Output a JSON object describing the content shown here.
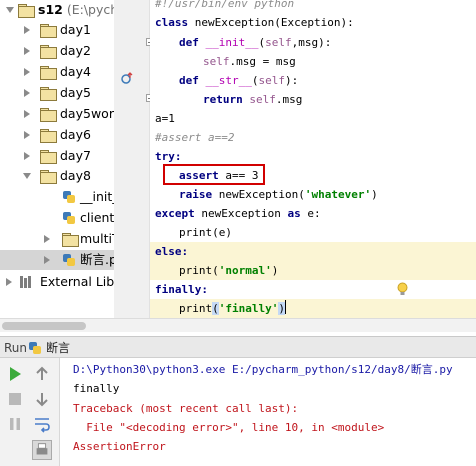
{
  "tree": {
    "root": {
      "name": "s12",
      "path": "(E:\\pycha"
    },
    "items": [
      {
        "label": "day1"
      },
      {
        "label": "day2"
      },
      {
        "label": "day4"
      },
      {
        "label": "day5"
      },
      {
        "label": "day5work"
      },
      {
        "label": "day6"
      },
      {
        "label": "day7"
      },
      {
        "label": "day8"
      }
    ],
    "day8_children": [
      {
        "label": "__init_"
      },
      {
        "label": "client."
      },
      {
        "label": "multiT"
      },
      {
        "label": "断言.py"
      }
    ],
    "external": "External Libra"
  },
  "code": {
    "shebang": "#!/usr/bin/env python",
    "l_class_kw": "class ",
    "l_class_rest": "newException(Exception):",
    "l_def1_kw": "def ",
    "l_def1_name": "__init__",
    "l_def1_a": "(",
    "l_def1_self": "self",
    "l_def1_b": ",msg):",
    "l_assign_self": "self",
    "l_assign_rest": ".msg = msg",
    "l_def2_name": "__str__",
    "l_def2_a": "(",
    "l_def2_self": "self",
    "l_def2_b": "):",
    "l_return_kw": "return ",
    "l_return_self": "self",
    "l_return_rest": ".msg",
    "l_a1": "a=1",
    "l_comment": "#assert a==2",
    "l_try": "try:",
    "l_assert_kw": "assert ",
    "l_assert_rest": "a== 3",
    "l_raise_kw": "raise ",
    "l_raise_a": "newException(",
    "l_raise_str": "'whatever'",
    "l_raise_b": ")",
    "l_except_kw": "except ",
    "l_except_a": "newException ",
    "l_except_as": "as ",
    "l_except_b": "e:",
    "l_print_e": "print(e)",
    "l_else": "else:",
    "l_print_normal_a": "print(",
    "l_print_normal_s": "'normal'",
    "l_print_normal_b": ")",
    "l_finally": "finally:",
    "l_print_finally_a": "print",
    "l_print_finally_p": "(",
    "l_print_finally_s": "'finally'",
    "l_print_finally_b": ")"
  },
  "run": {
    "tab_label": "Run",
    "config_name": "断言",
    "output": {
      "cmd": "D:\\Python30\\python3.exe E:/pycharm_python/s12/day8/断言.py",
      "line1": "finally",
      "tb1": "Traceback (most recent call last):",
      "tb2": "  File \"<decoding error>\", line 10, in <module>",
      "tb3": "AssertionError"
    }
  },
  "icons": {
    "run": "play-icon",
    "stop": "stop-icon",
    "pause": "pause-icon",
    "up": "arrow-up-icon",
    "down": "arrow-down-icon",
    "wrap": "soft-wrap-icon",
    "print": "print-icon"
  },
  "colors": {
    "keyword": "#000080",
    "string": "#008000",
    "self": "#94558d",
    "error": "#c0151c",
    "highlight": "#fbf5d4",
    "annotation_box": "#d10000"
  }
}
